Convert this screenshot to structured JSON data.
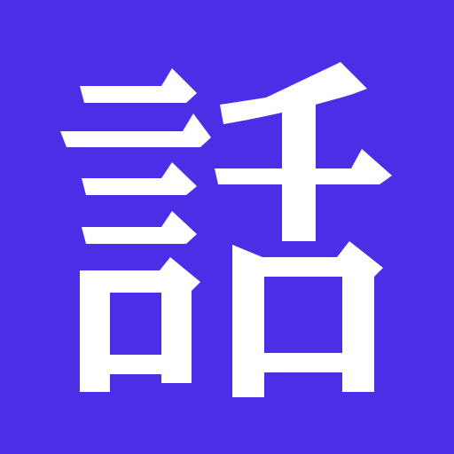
{
  "icon": {
    "name": "kanji-hanashi-icon",
    "glyph": "話",
    "background_color": "#4b2ee5",
    "glyph_color": "#ffffff"
  }
}
